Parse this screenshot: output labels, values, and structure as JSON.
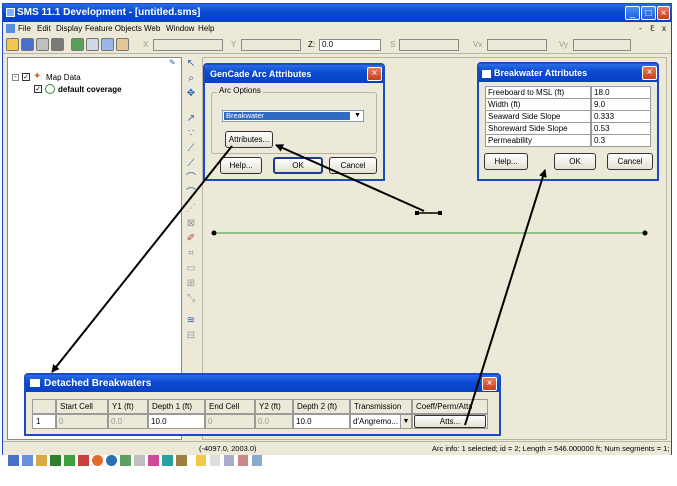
{
  "window": {
    "title": "SMS 11.1 Development - [untitled.sms]",
    "minimize_label": "_",
    "maximize_label": "□",
    "close_label": "×"
  },
  "menu": [
    "File",
    "Edit",
    "Display",
    "Feature Objects",
    "Web",
    "Window",
    "Help"
  ],
  "menu_right": {
    "minimize": "-",
    "restore": "ℇ",
    "close": "x"
  },
  "coords": {
    "x_label": "X",
    "y_label": "Y",
    "z_label": "Z:",
    "z_value": "0.0",
    "s_label": "S",
    "vx_label": "Vx",
    "vy_label": "Vy"
  },
  "tree": {
    "root": "Map Data",
    "child": "default coverage"
  },
  "status": {
    "xy": "(-4097.0, 2003.0)",
    "arc_info": "Arc info: 1 selected; id = 2; Length = 546.000000 ft; Num segments = 1;"
  },
  "gencade_dialog": {
    "title": "GenCade Arc Attributes",
    "group_label": "Arc Options",
    "selected_option": "Breakwater",
    "attributes_button": "Attributes...",
    "help_button": "Help...",
    "ok_button": "OK",
    "cancel_button": "Cancel"
  },
  "breakwater_dialog": {
    "title": "Breakwater Attributes",
    "rows": [
      {
        "label": "Freeboard to MSL (ft)",
        "value": "18.0"
      },
      {
        "label": "Width (ft)",
        "value": "9.0"
      },
      {
        "label": "Seaward Side Slope",
        "value": "0.333"
      },
      {
        "label": "Shoreward Side Slope",
        "value": "0.53"
      },
      {
        "label": "Permeability",
        "value": "0.3"
      }
    ],
    "help_button": "Help...",
    "ok_button": "OK",
    "cancel_button": "Cancel"
  },
  "detached_dialog": {
    "title": "Detached Breakwaters",
    "columns": [
      "Start Cell",
      "Y1 (ft)",
      "Depth 1 (ft)",
      "End Cell",
      "Y2 (ft)",
      "Depth 2 (ft)",
      "Transmission",
      "Coeff/Perm/Atts"
    ],
    "row": {
      "index": "1",
      "start_cell": "0",
      "y1": "0.0",
      "depth1": "10.0",
      "end_cell": "0",
      "y2": "0.0",
      "depth2": "10.0",
      "transmission": "d'Angremo...",
      "atts_button": "Atts..."
    }
  },
  "colors": {
    "title_blue": "#0a4ad0",
    "arc_line": "#3a9a3a",
    "close_red": "#c8401f"
  }
}
